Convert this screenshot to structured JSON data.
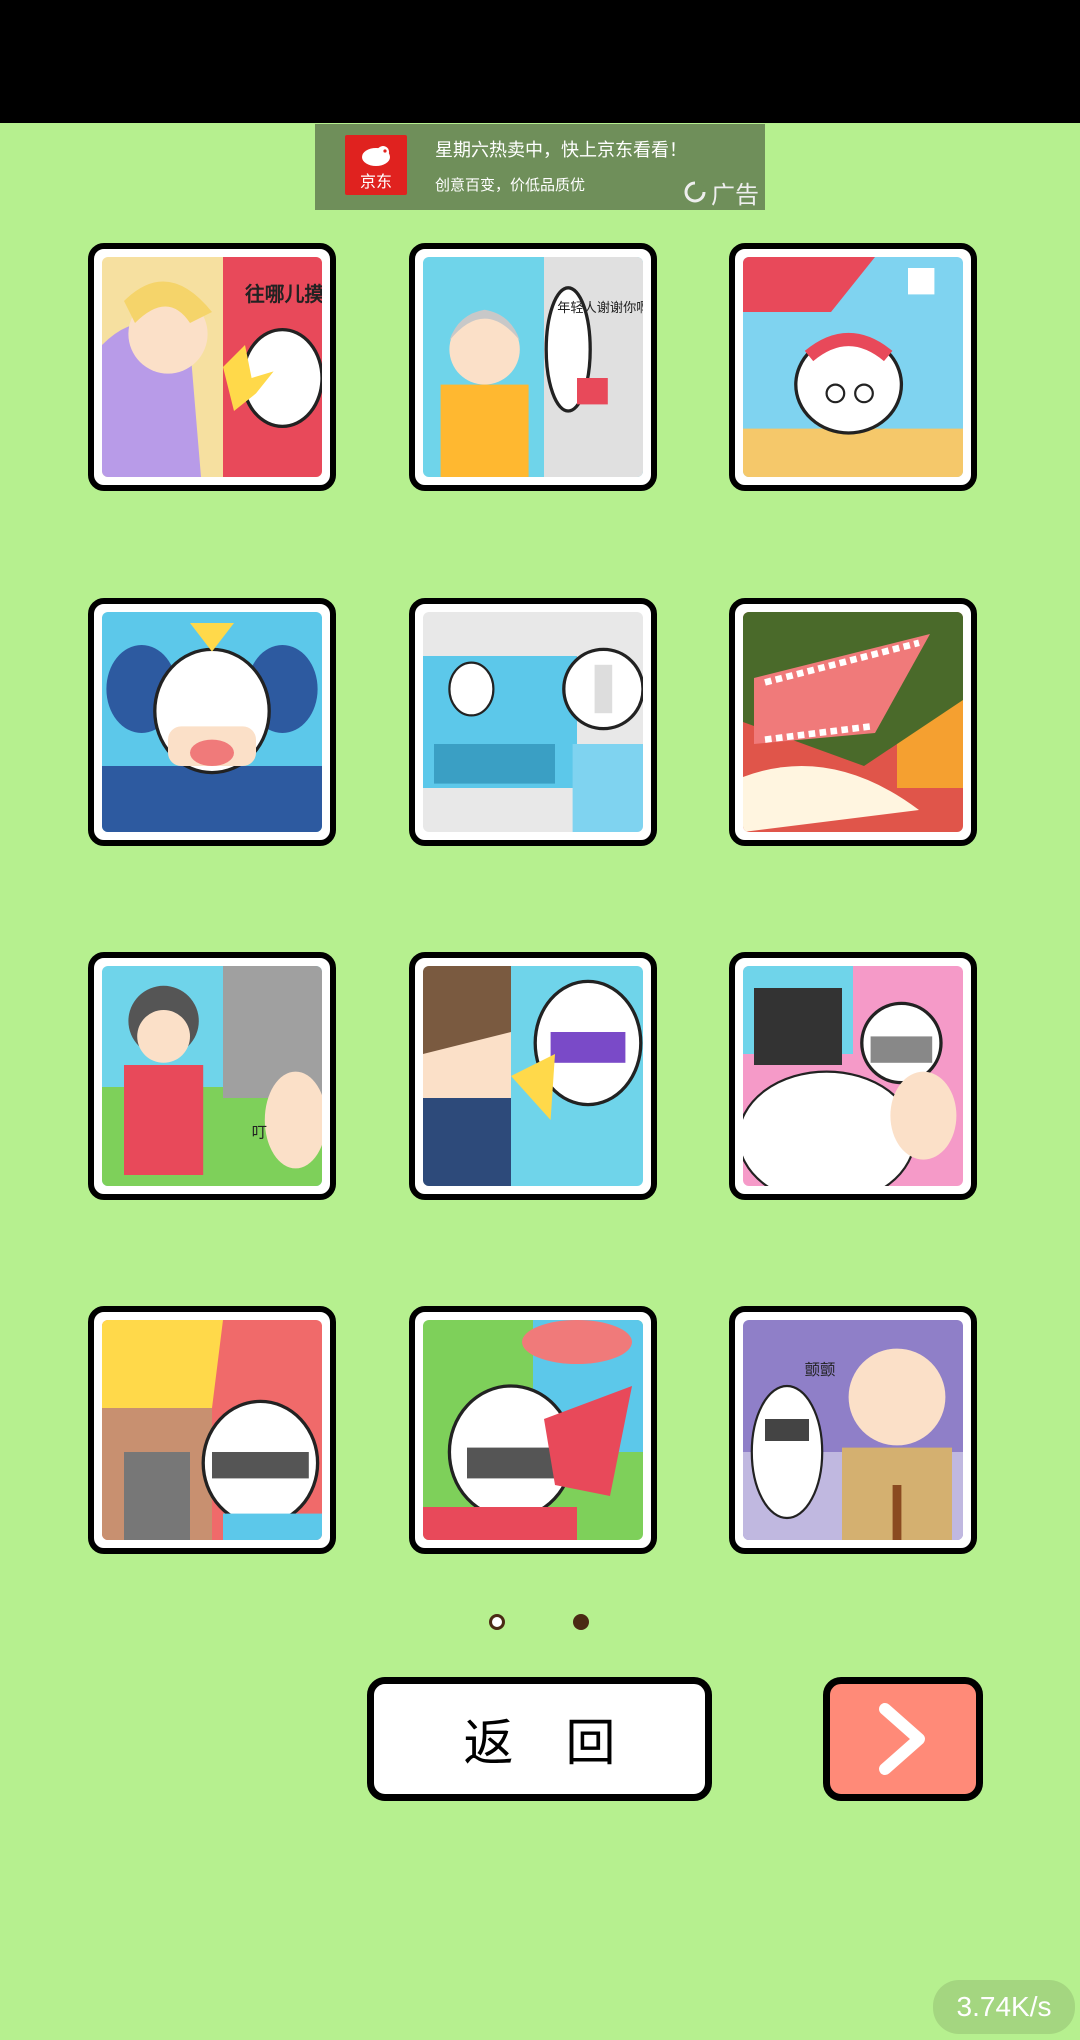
{
  "ad": {
    "logo_text": "京东",
    "title": "星期六热卖中，快上京东看看！",
    "subtitle": "创意百变，价低品质优",
    "tag": "广告"
  },
  "levels": [
    {
      "caption": "往哪儿摸呢你这色狼",
      "bg": "#f6e0a0"
    },
    {
      "caption": "年轻人谢谢你啊",
      "bg": "#6fd4ea"
    },
    {
      "caption": "",
      "bg": "#7fd3f0"
    },
    {
      "caption": "",
      "bg": "#5cc8ea"
    },
    {
      "caption": "",
      "bg": "#5cc8ea"
    },
    {
      "caption": "",
      "bg": "#e0554a"
    },
    {
      "caption": "叮",
      "bg": "#6fd4ea"
    },
    {
      "caption": "",
      "bg": "#6fd4ea"
    },
    {
      "caption": "",
      "bg": "#f59ac8"
    },
    {
      "caption": "",
      "bg": "#f06a6a"
    },
    {
      "caption": "",
      "bg": "#7ed05a"
    },
    {
      "caption": "颤颤",
      "bg": "#8f7fc8"
    }
  ],
  "pager": {
    "pages": 2,
    "current": 2
  },
  "buttons": {
    "back_label": "返回"
  },
  "network_speed": "3.74K/s",
  "colors": {
    "background": "#b6f08f",
    "next_button": "#ff8a78",
    "accent_dark": "#4a2a14"
  }
}
